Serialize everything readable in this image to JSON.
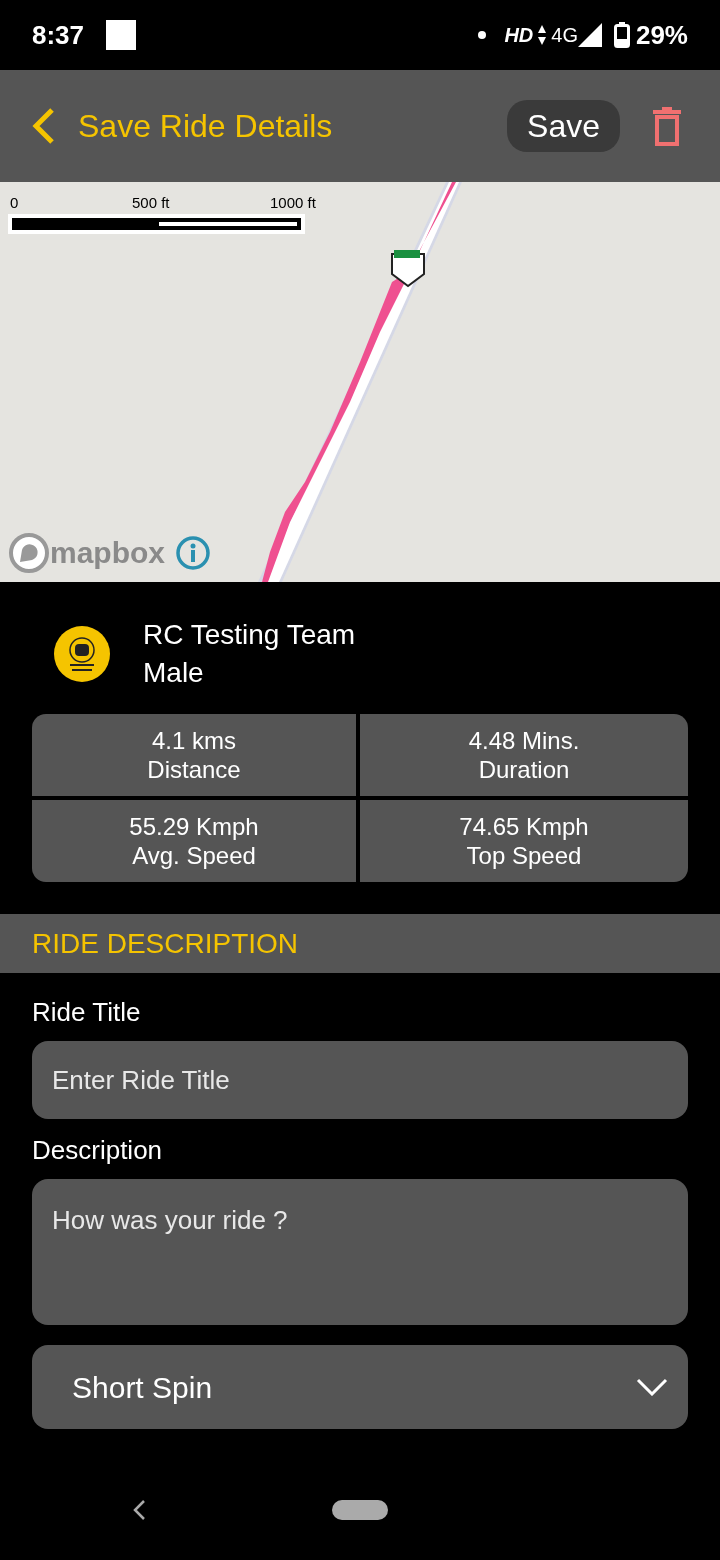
{
  "status_bar": {
    "time": "8:37",
    "network": "HD",
    "cellular": "4G",
    "battery": "29%"
  },
  "header": {
    "title": "Save Ride Details",
    "save_button": "Save"
  },
  "map": {
    "scale_labels": [
      "0",
      "500 ft",
      "1000 ft"
    ],
    "attribution": "mapbox"
  },
  "profile": {
    "name": "RC Testing Team",
    "gender": "Male"
  },
  "stats": [
    {
      "value": "4.1 kms",
      "label": "Distance"
    },
    {
      "value": "4.48 Mins.",
      "label": "Duration"
    },
    {
      "value": "55.29 Kmph",
      "label": "Avg. Speed"
    },
    {
      "value": "74.65 Kmph",
      "label": "Top Speed"
    }
  ],
  "section_title": "RIDE DESCRIPTION",
  "form": {
    "title_label": "Ride Title",
    "title_placeholder": "Enter Ride Title",
    "description_label": "Description",
    "description_placeholder": "How was your ride ?",
    "ride_type": "Short Spin"
  }
}
